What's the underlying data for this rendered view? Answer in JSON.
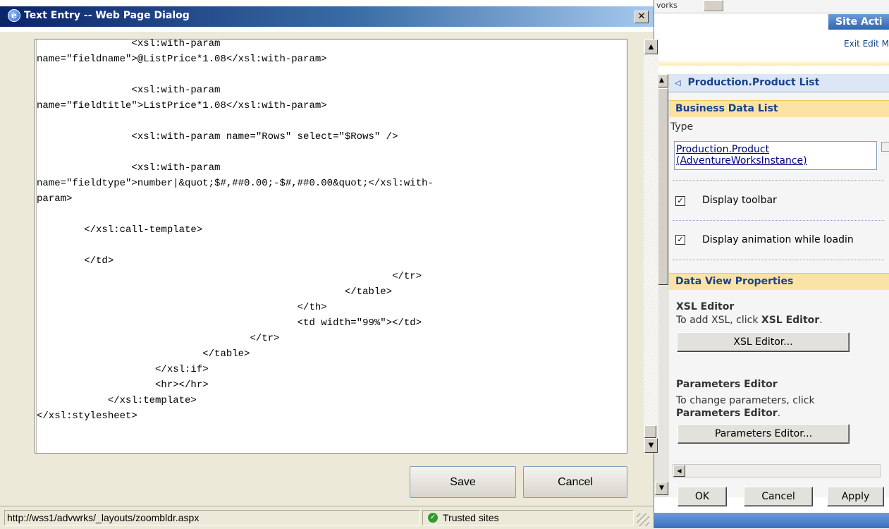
{
  "dialog": {
    "title": "Text Entry -- Web Page Dialog",
    "close_glyph": "✕",
    "icon": "ie-icon",
    "code_text": "                <xsl:with-param\nname=\"fieldname\">@ListPrice*1.08</xsl:with-param>\n\n                <xsl:with-param\nname=\"fieldtitle\">ListPrice*1.08</xsl:with-param>\n\n                <xsl:with-param name=\"Rows\" select=\"$Rows\" />\n\n                <xsl:with-param\nname=\"fieldtype\">number|&quot;$#,##0.00;-$#,##0.00&quot;</xsl:with-\nparam>\n\n        </xsl:call-template>\n\n        </td>\n                                                            </tr>\n                                                    </table>\n                                            </th>\n                                            <td width=\"99%\"></td>\n                                    </tr>\n                            </table>\n                    </xsl:if>\n                    <hr></hr>\n            </xsl:template>\n</xsl:stylesheet>",
    "save_label": "Save",
    "cancel_label": "Cancel",
    "status_url": "http://wss1/advwrks/_layouts/zoombldr.aspx",
    "status_zone": "Trusted sites"
  },
  "background": {
    "top_fragment": "vorks",
    "site_actions": "Site Acti",
    "exit_edit": "Exit Edit M",
    "toolpane": {
      "title": "Production.Product List",
      "section1": "Business Data List",
      "type_label": "Type",
      "type_value_line1": "Production.Product",
      "type_value_line2": "(AdventureWorksInstance)",
      "display_toolbar": "Display toolbar",
      "display_animation": "Display animation while loadin",
      "section2": "Data View Properties",
      "xsl_heading": "XSL Editor",
      "xsl_text_prefix": "To add XSL, click ",
      "xsl_text_bold": "XSL Editor",
      "xsl_text_suffix": ".",
      "xsl_button": "XSL Editor...",
      "params_heading": "Parameters Editor",
      "params_text_line1": "To change parameters, click",
      "params_text_bold": "Parameters Editor",
      "params_text_suffix": ".",
      "params_button": "Parameters Editor...",
      "ok": "OK",
      "cancel": "Cancel",
      "apply": "Apply",
      "checked_glyph": "✓"
    }
  },
  "colors": {
    "titlebar_start": "#0a246a",
    "section_band": "#fbe3a6",
    "link": "#15428b"
  }
}
